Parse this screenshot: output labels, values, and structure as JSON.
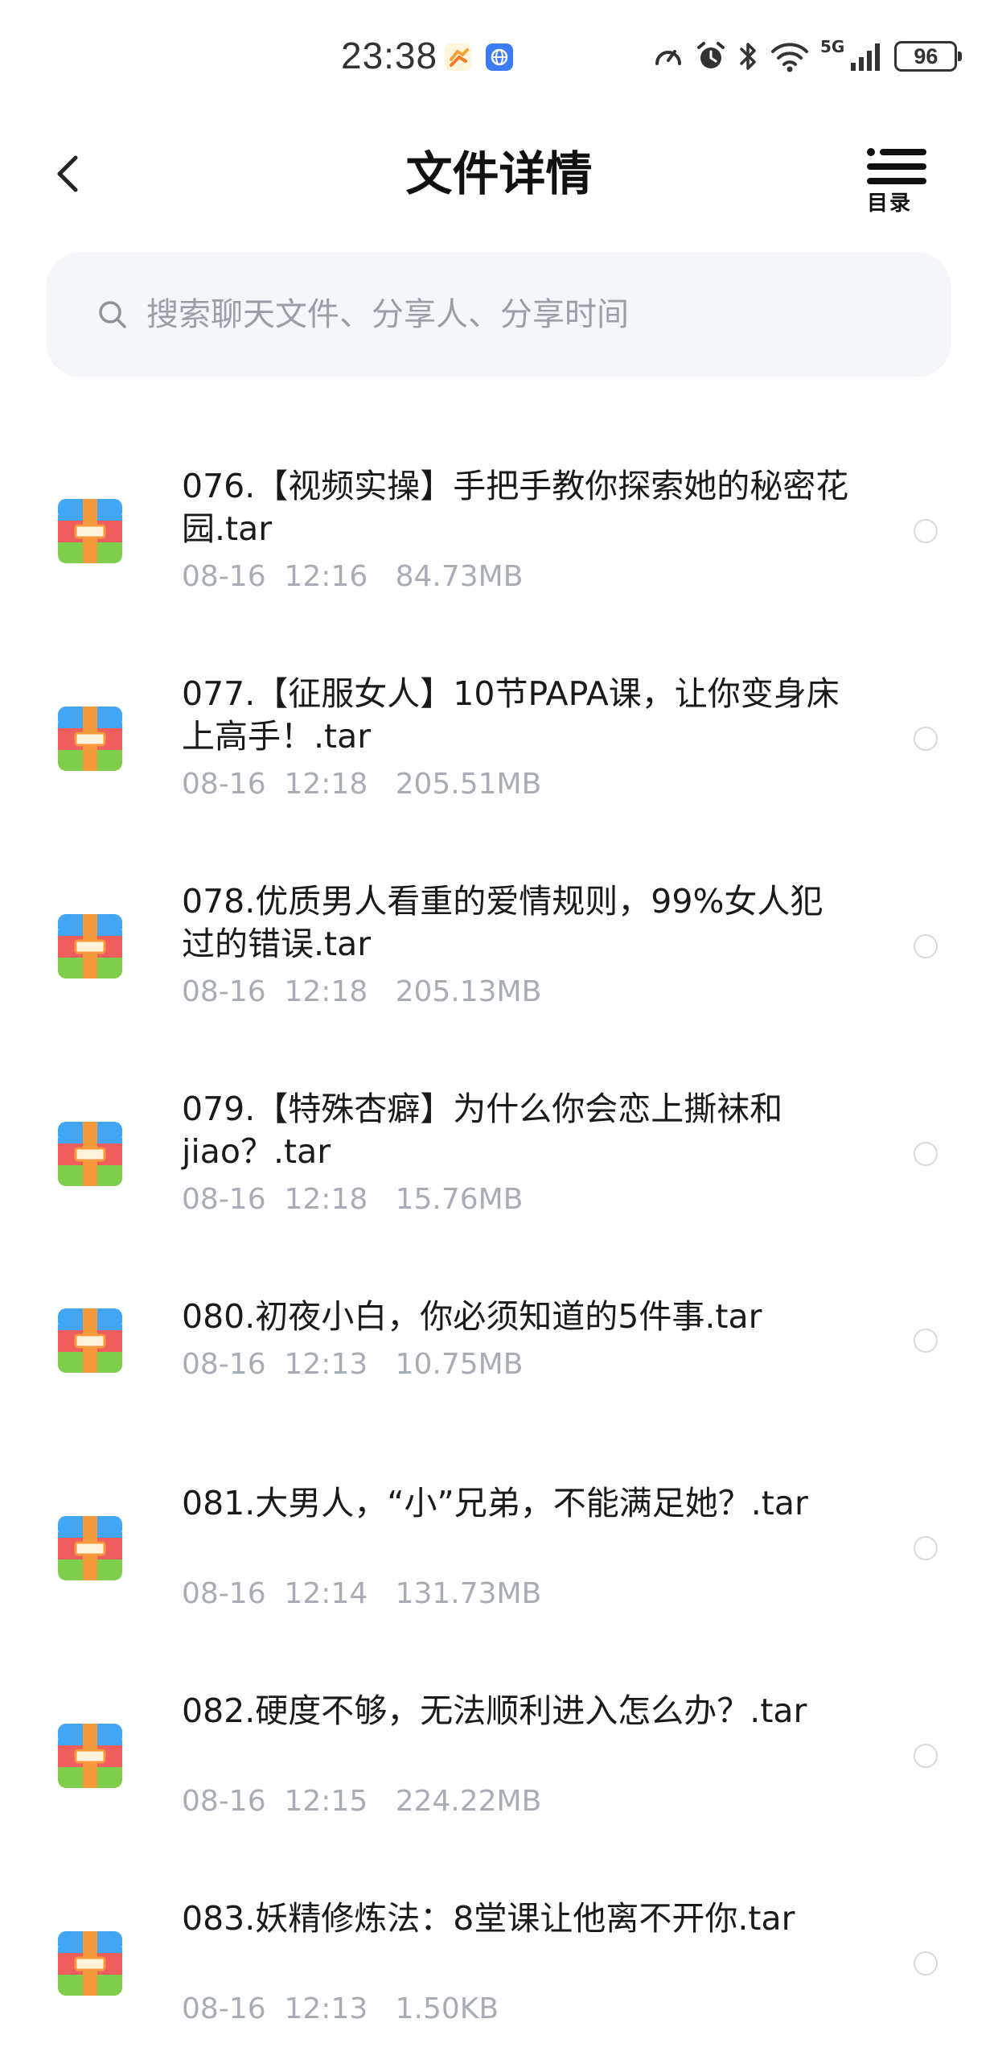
{
  "status_bar": {
    "time": "23:38",
    "signal_label": "5G",
    "battery": "96"
  },
  "header": {
    "title": "文件详情",
    "toc_label": "目录"
  },
  "search": {
    "placeholder": "搜索聊天文件、分享人、分享时间"
  },
  "files": [
    {
      "name": "076.【视频实操】手把手教你探索她的秘密花园.tar",
      "date": "08-16",
      "time": "12:16",
      "size": "84.73MB"
    },
    {
      "name": "077.【征服女人】10节PAPA课，让你变身床上高手！.tar",
      "date": "08-16",
      "time": "12:18",
      "size": "205.51MB"
    },
    {
      "name": "078.优质男人看重的爱情规则，99%女人犯过的错误.tar",
      "date": "08-16",
      "time": "12:18",
      "size": "205.13MB"
    },
    {
      "name": "079.【特殊杏癖】为什么你会恋上撕袜和jiao？.tar",
      "date": "08-16",
      "time": "12:18",
      "size": "15.76MB"
    },
    {
      "name": "080.初夜小白，你必须知道的5件事.tar",
      "date": "08-16",
      "time": "12:13",
      "size": "10.75MB"
    },
    {
      "name": "081.大男人，“小”兄弟，不能满足她？.tar",
      "date": "08-16",
      "time": "12:14",
      "size": "131.73MB"
    },
    {
      "name": "082.硬度不够，无法顺利进入怎么办？.tar",
      "date": "08-16",
      "time": "12:15",
      "size": "224.22MB"
    },
    {
      "name": "083.妖精修炼法：8堂课让他离不开你.tar",
      "date": "08-16",
      "time": "12:13",
      "size": "1.50KB"
    }
  ]
}
